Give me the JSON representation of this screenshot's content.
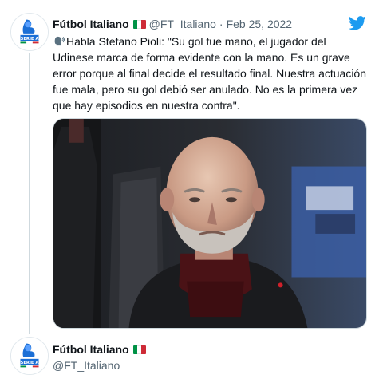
{
  "tweet": {
    "author_name": "Fútbol Italiano",
    "flag_icon": "italy-flag-icon",
    "handle": "@FT_Italiano",
    "separator": "·",
    "date": "Feb 25, 2022",
    "speaker_icon": "speaking-head-icon",
    "text": "Habla Stefano Pioli: \"Su gol fue mano, el jugador del Udinese marca de forma evidente con la mano. Es un grave error porque al final decide el resultado final. Nuestra actuación fue mala, pero su gol debió ser anulado. No es la primera vez que hay episodios en nuestra contra\".",
    "avatar_logo_text": "SERIE A",
    "twitter_icon": "twitter-bird-icon",
    "media_description": "photo"
  },
  "quoted": {
    "author_name": "Fútbol Italiano",
    "flag_icon": "italy-flag-icon",
    "handle": "@FT_Italiano",
    "avatar_logo_text": "SERIE A"
  },
  "colors": {
    "twitter_blue": "#1d9bf0",
    "serie_a_blue": "#1b6fd6",
    "flag_green": "#009246",
    "flag_white": "#ffffff",
    "flag_red": "#ce2b37"
  }
}
